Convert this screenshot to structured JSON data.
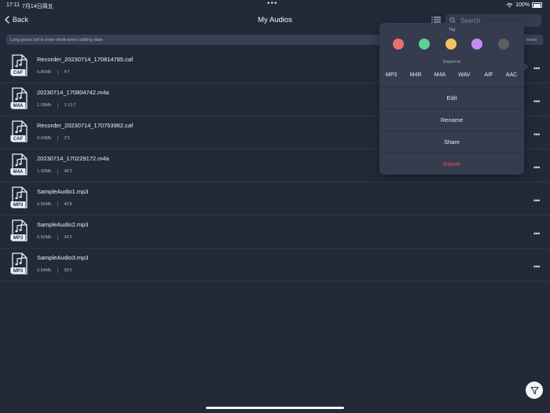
{
  "status": {
    "time": "17:11",
    "date": "7月14日周五",
    "battery": "100%"
  },
  "nav": {
    "back_label": "Back",
    "title": "My Audios",
    "search_placeholder": "Search"
  },
  "hint": {
    "text": "Long press cell to enter multi-select editing state",
    "tail": "kmsx"
  },
  "files": [
    {
      "name": "Recorder_20230714_170814785.caf",
      "badge": "CAF",
      "size": "0.86Mb",
      "duration": "4'7"
    },
    {
      "name": "20230714_170804742.m4a",
      "badge": "M4A",
      "size": "1.09Mb",
      "duration": "1:13.7"
    },
    {
      "name": "Recorder_20230714_170753962.caf",
      "badge": "CAF",
      "size": "0.43Mb",
      "duration": "2'3"
    },
    {
      "name": "20230714_170229172.m4a",
      "badge": "M4A",
      "size": "1.30Mb",
      "duration": "46'3"
    },
    {
      "name": "SampleAudio1.mp3",
      "badge": "MP3",
      "size": "0.65Mb",
      "duration": "42'8"
    },
    {
      "name": "SampleAudio2.mp3",
      "badge": "MP3",
      "size": "0.52Mb",
      "duration": "34'2"
    },
    {
      "name": "SampleAudio3.mp3",
      "badge": "MP3",
      "size": "0.54Mb",
      "duration": "35'0"
    }
  ],
  "popover": {
    "tag_label": "Tag",
    "tag_colors": [
      "#e87070",
      "#5ed08f",
      "#f4c15d",
      "#c48bf5",
      "#5e5e5e"
    ],
    "export_label": "Export to",
    "formats": [
      "MP3",
      "M4R",
      "M4A",
      "WAV",
      "AIF",
      "AAC"
    ],
    "actions": [
      "Edit",
      "Rename",
      "Share",
      "Delete"
    ]
  },
  "colors": {
    "background": "#222a3a",
    "surface": "#343c4d",
    "delete": "#e8535f"
  }
}
